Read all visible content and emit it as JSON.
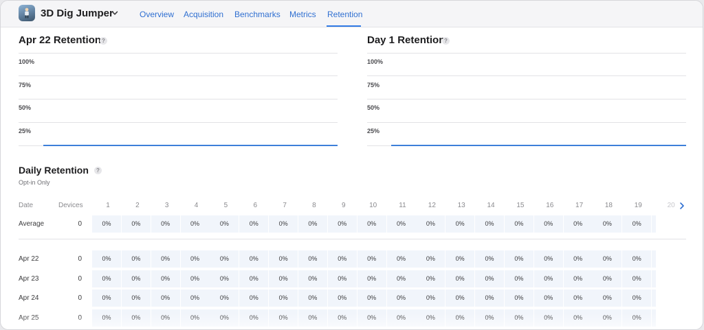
{
  "app": {
    "name": "3D Dig Jumper"
  },
  "tabs": [
    {
      "label": "Overview"
    },
    {
      "label": "Acquisition"
    },
    {
      "label": "Benchmarks"
    },
    {
      "label": "Metrics"
    },
    {
      "label": "Retention",
      "active": true
    }
  ],
  "charts": {
    "left": {
      "title": "Apr 22 Retention",
      "help": "?",
      "ticks": [
        "100%",
        "75%",
        "50%",
        "25%"
      ]
    },
    "right": {
      "title": "Day 1 Retention",
      "help": "?",
      "ticks": [
        "100%",
        "75%",
        "50%",
        "25%"
      ]
    }
  },
  "chart_data": [
    {
      "type": "line",
      "title": "Apr 22 Retention",
      "y_ticks": [
        "100%",
        "75%",
        "50%",
        "25%"
      ],
      "ylim": [
        0,
        100
      ],
      "series": [
        {
          "values": [
            0
          ]
        }
      ]
    },
    {
      "type": "line",
      "title": "Day 1 Retention",
      "y_ticks": [
        "100%",
        "75%",
        "50%",
        "25%"
      ],
      "ylim": [
        0,
        100
      ],
      "series": [
        {
          "values": [
            0
          ]
        }
      ]
    }
  ],
  "daily": {
    "title": "Daily Retention",
    "help": "?",
    "subtitle": "Opt-in Only",
    "columns": {
      "date": "Date",
      "devices": "Devices"
    },
    "days": [
      "1",
      "2",
      "3",
      "4",
      "5",
      "6",
      "7",
      "8",
      "9",
      "10",
      "11",
      "12",
      "13",
      "14",
      "15",
      "16",
      "17",
      "18",
      "19",
      "20"
    ],
    "average": {
      "label": "Average",
      "devices": "0",
      "values": [
        "0%",
        "0%",
        "0%",
        "0%",
        "0%",
        "0%",
        "0%",
        "0%",
        "0%",
        "0%",
        "0%",
        "0%",
        "0%",
        "0%",
        "0%",
        "0%",
        "0%",
        "0%",
        "0%"
      ]
    },
    "rows": [
      {
        "date": "Apr 22",
        "devices": "0",
        "values": [
          "0%",
          "0%",
          "0%",
          "0%",
          "0%",
          "0%",
          "0%",
          "0%",
          "0%",
          "0%",
          "0%",
          "0%",
          "0%",
          "0%",
          "0%",
          "0%",
          "0%",
          "0%",
          "0%"
        ]
      },
      {
        "date": "Apr 23",
        "devices": "0",
        "values": [
          "0%",
          "0%",
          "0%",
          "0%",
          "0%",
          "0%",
          "0%",
          "0%",
          "0%",
          "0%",
          "0%",
          "0%",
          "0%",
          "0%",
          "0%",
          "0%",
          "0%",
          "0%",
          "0%"
        ]
      },
      {
        "date": "Apr 24",
        "devices": "0",
        "values": [
          "0%",
          "0%",
          "0%",
          "0%",
          "0%",
          "0%",
          "0%",
          "0%",
          "0%",
          "0%",
          "0%",
          "0%",
          "0%",
          "0%",
          "0%",
          "0%",
          "0%",
          "0%",
          "0%"
        ]
      },
      {
        "date": "Apr 25",
        "devices": "0",
        "values": [
          "0%",
          "0%",
          "0%",
          "0%",
          "0%",
          "0%",
          "0%",
          "0%",
          "0%",
          "0%",
          "0%",
          "0%",
          "0%",
          "0%",
          "0%",
          "0%",
          "0%",
          "0%",
          "0%"
        ]
      }
    ],
    "next_icon": "chevron-right-icon"
  },
  "colors": {
    "accent": "#2f6fd1",
    "cell_bg": "#f1f5fb",
    "chart_line": "#3d7fd9"
  }
}
